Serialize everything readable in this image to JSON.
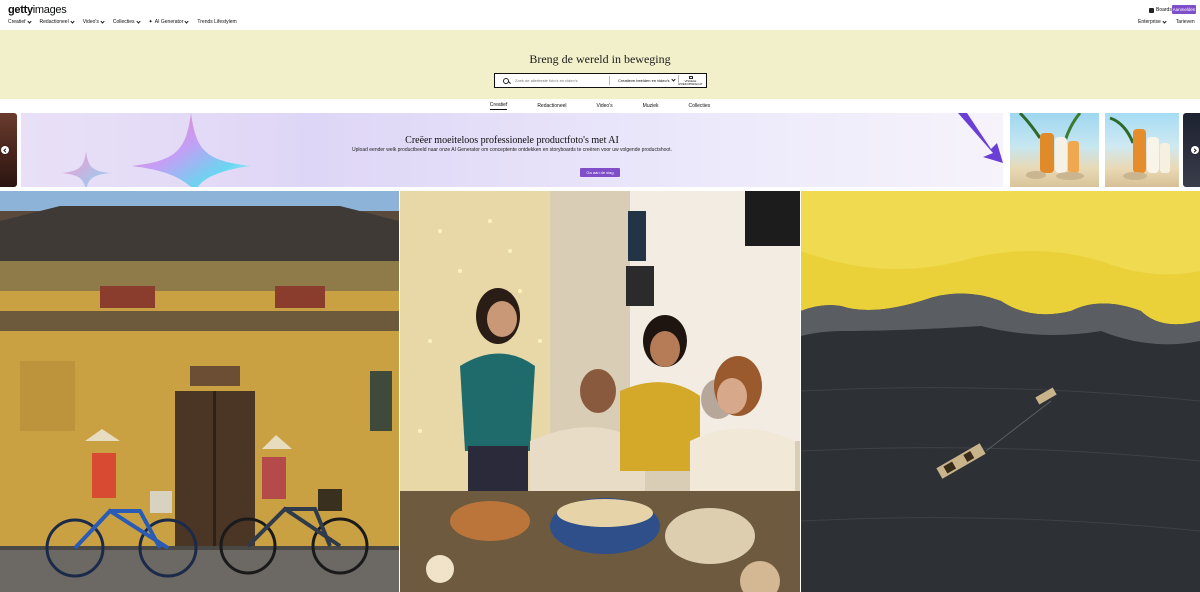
{
  "brand": {
    "logo_bold": "getty",
    "logo_light": "images",
    "accent": "#7f4ec9",
    "hero_bg": "#f1f0cb"
  },
  "nav": {
    "items": [
      {
        "label": "Creatief"
      },
      {
        "label": "Redactioneel"
      },
      {
        "label": "Video's"
      },
      {
        "label": "Collecties"
      },
      {
        "label": "AI Generator"
      },
      {
        "label": "Trends Lifestylem"
      }
    ]
  },
  "header": {
    "boards_label": "Boards",
    "signin_label": "Aanmelden",
    "enterprise_label": "Enterprise",
    "pricing_label": "Tarieven"
  },
  "hero": {
    "title": "Breng de wereld in beweging",
    "search_placeholder": "Zoek de allerbeste foto's en video's",
    "filter_label": "Creatieve beelden en video's",
    "visual_search_label": "VISUELE ZOEKOPDRACHT"
  },
  "tabs": [
    {
      "label": "Creatief",
      "active": true
    },
    {
      "label": "Redactioneel",
      "active": false
    },
    {
      "label": "Video's",
      "active": false
    },
    {
      "label": "Muziek",
      "active": false
    },
    {
      "label": "Collecties",
      "active": false
    }
  ],
  "banner": {
    "title": "Creëer moeiteloos professionele productfoto's met AI",
    "subtitle": "Upload eender welk productbeeld naar onze AI Generator om conceptente ontdekken en storyboards te creëren voor uw volgende productshoot.",
    "button_label": "Ga aan de slag"
  },
  "icons": {
    "search": "search-icon",
    "camera": "camera-icon",
    "cart": "cart-icon",
    "board": "board-icon",
    "prev": "chevron-left-icon",
    "next": "chevron-right-icon"
  }
}
